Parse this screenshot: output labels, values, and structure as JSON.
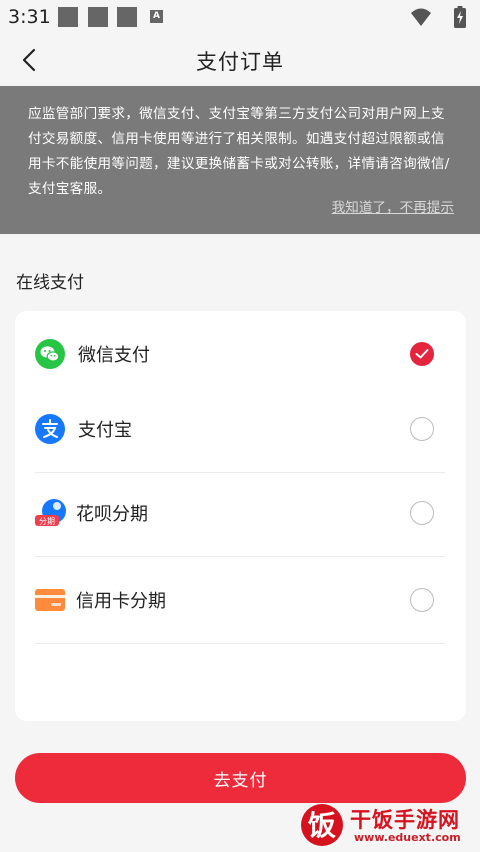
{
  "status_bar": {
    "time": "3:31",
    "a_badge": "A"
  },
  "nav": {
    "title": "支付订单",
    "back_icon": "chevron-left-icon"
  },
  "notice": {
    "text": "应监管部门要求，微信支付、支付宝等第三方支付公司对用户网上支付交易额度、信用卡使用等进行了相关限制。如遇支付超过限额或信用卡不能使用等问题，建议更换储蓄卡或对公转账，详情请咨询微信/支付宝客服。",
    "dismiss": "我知道了，不再提示"
  },
  "section": {
    "label": "在线支付"
  },
  "payment_methods": [
    {
      "label": "微信支付",
      "icon": "wechat-pay-icon",
      "selected": true
    },
    {
      "label": "支付宝",
      "icon": "alipay-icon",
      "selected": false
    },
    {
      "label": "花呗分期",
      "icon": "huabei-icon",
      "icon_text": "分期",
      "selected": false
    },
    {
      "label": "信用卡分期",
      "icon": "credit-card-icon",
      "selected": false
    }
  ],
  "submit": {
    "label": "去支付"
  },
  "watermark": {
    "name": "干饭手游网",
    "url": "www.eduext.com",
    "logo_char": "饭"
  },
  "colors": {
    "accent": "#ee2b3b",
    "wechat": "#28c445",
    "alipay": "#1677ff",
    "notice_bg": "#7a7a7a"
  }
}
